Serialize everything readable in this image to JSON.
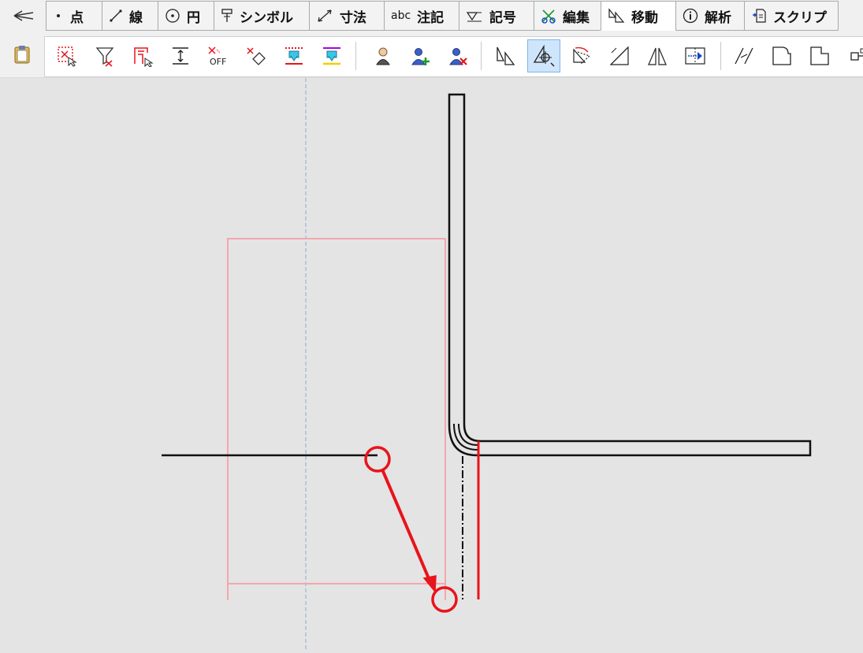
{
  "tabbar": {
    "tabs": [
      {
        "label": "点",
        "icon": "point-icon"
      },
      {
        "label": "線",
        "icon": "line-icon"
      },
      {
        "label": "円",
        "icon": "circle-icon"
      },
      {
        "label": "シンボル",
        "icon": "symbol-icon"
      },
      {
        "label": "寸法",
        "icon": "dimension-icon"
      },
      {
        "label": "注記",
        "icon": "text-icon",
        "icon_text": "abc"
      },
      {
        "label": "記号",
        "icon": "mark-icon"
      },
      {
        "label": "編集",
        "icon": "edit-icon"
      },
      {
        "label": "移動",
        "icon": "move-icon",
        "active": true
      },
      {
        "label": "解析",
        "icon": "info-icon"
      },
      {
        "label": "スクリプ",
        "icon": "script-icon"
      }
    ]
  },
  "toolbar": {
    "buttons": [
      {
        "icon": "select-region-icon"
      },
      {
        "icon": "filter-icon"
      },
      {
        "icon": "select-chain-icon"
      },
      {
        "icon": "height-icon"
      },
      {
        "icon": "snap-off-icon",
        "icon_text": "OFF"
      },
      {
        "icon": "erase-icon"
      },
      {
        "icon": "layer-down-icon"
      },
      {
        "icon": "layer-down-yellow-icon"
      },
      {
        "icon": "user-icon"
      },
      {
        "icon": "user-add-icon"
      },
      {
        "icon": "user-remove-icon"
      },
      {
        "icon": "mirror-icon"
      },
      {
        "icon": "move-point-icon",
        "active": true
      },
      {
        "icon": "rotate-icon"
      },
      {
        "icon": "scale-icon"
      },
      {
        "icon": "triangle-icon"
      },
      {
        "icon": "array-move-icon"
      },
      {
        "icon": "parallel-icon"
      },
      {
        "icon": "fillet-shape-icon"
      },
      {
        "icon": "chamfer-shape-icon"
      },
      {
        "icon": "connector-icon"
      }
    ]
  },
  "colors": {
    "accent_red": "#e8141b",
    "preview_pink": "#f4a6ad",
    "guide_blue": "#9fb6d0",
    "line_black": "#111111"
  }
}
